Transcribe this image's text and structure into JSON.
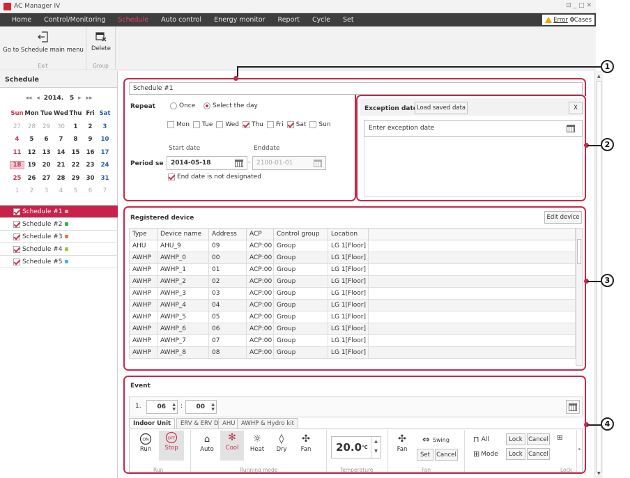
{
  "window": {
    "title": "AC Manager IV",
    "controls": "⊡ _ □ ✕"
  },
  "menu": {
    "items": [
      "Home",
      "Control/Monitoring",
      "Schedule",
      "Auto control",
      "Energy monitor",
      "Report",
      "Cycle",
      "Set"
    ],
    "active": "Schedule",
    "error_label": "Error",
    "error_count": "0",
    "error_suffix": "Cases"
  },
  "toolbar": {
    "go_main_label": "Go to Schedule main menu",
    "delete_label": "Delete",
    "group1": "Exit",
    "group2": "Group"
  },
  "left": {
    "title": "Schedule",
    "cal_nav": {
      "prev_year": "◂◂",
      "prev": "◂",
      "year": "2014.",
      "month": "5",
      "next": "▸",
      "next_year": "▸▸"
    },
    "weekdays": [
      "Sun",
      "Mon",
      "Tue",
      "Wed",
      "Thu",
      "Fri",
      "Sat"
    ],
    "weeks": [
      [
        "27",
        "28",
        "29",
        "30",
        "1",
        "2",
        "3"
      ],
      [
        "4",
        "5",
        "6",
        "7",
        "8",
        "9",
        "10"
      ],
      [
        "11",
        "12",
        "13",
        "14",
        "15",
        "16",
        "17"
      ],
      [
        "18",
        "19",
        "20",
        "21",
        "22",
        "23",
        "24"
      ],
      [
        "25",
        "26",
        "27",
        "28",
        "29",
        "30",
        "31"
      ],
      [
        "1",
        "2",
        "3",
        "4",
        "5",
        "6",
        "7"
      ]
    ],
    "schedules": [
      {
        "label": "Schedule #1",
        "color": "#f0a0b4"
      },
      {
        "label": "Schedule #2",
        "color": "#3cb04a"
      },
      {
        "label": "Schedule #3",
        "color": "#f07850"
      },
      {
        "label": "Schedule #4",
        "color": "#a0c83c"
      },
      {
        "label": "Schedule #5",
        "color": "#50b4e6"
      }
    ]
  },
  "schedule": {
    "name": "Schedule #1",
    "repeat_label": "Repeat",
    "once_label": "Once",
    "select_day_label": "Select the day",
    "days": [
      {
        "label": "Mon",
        "checked": false
      },
      {
        "label": "Tue",
        "checked": false
      },
      {
        "label": "Wed",
        "checked": false
      },
      {
        "label": "Thu",
        "checked": true
      },
      {
        "label": "Fri",
        "checked": false
      },
      {
        "label": "Sat",
        "checked": true
      },
      {
        "label": "Sun",
        "checked": false
      }
    ],
    "period_label": "Period se",
    "start_caption": "Start date",
    "end_caption": "Enddate",
    "start_date": "2014-05-18",
    "end_date": "2100-01-01",
    "dash": "-",
    "end_not_designated": "End date is not designated"
  },
  "exception": {
    "title": "Exception date",
    "load_button": "Load saved data",
    "close": "X",
    "placeholder": "Enter exception date"
  },
  "devices": {
    "title": "Registered device",
    "edit_button": "Edit device",
    "columns": [
      "Type",
      "Device name",
      "Address",
      "ACP",
      "Control group",
      "Location"
    ],
    "rows": [
      [
        "AHU",
        "AHU_9",
        "09",
        "ACP:00",
        "Group",
        "LG 1[Floor]"
      ],
      [
        "AWHP",
        "AWHP_0",
        "00",
        "ACP:00",
        "Group",
        "LG 1[Floor]"
      ],
      [
        "AWHP",
        "AWHP_1",
        "01",
        "ACP:00",
        "Group",
        "LG 1[Floor]"
      ],
      [
        "AWHP",
        "AWHP_2",
        "02",
        "ACP:00",
        "Group",
        "LG 1[Floor]"
      ],
      [
        "AWHP",
        "AWHP_3",
        "03",
        "ACP:00",
        "Group",
        "LG 1[Floor]"
      ],
      [
        "AWHP",
        "AWHP_4",
        "04",
        "ACP:00",
        "Group",
        "LG 1[Floor]"
      ],
      [
        "AWHP",
        "AWHP_5",
        "05",
        "ACP:00",
        "Group",
        "LG 1[Floor]"
      ],
      [
        "AWHP",
        "AWHP_6",
        "06",
        "ACP:00",
        "Group",
        "LG 1[Floor]"
      ],
      [
        "AWHP",
        "AWHP_7",
        "07",
        "ACP:00",
        "Group",
        "LG 1[Floor]"
      ],
      [
        "AWHP",
        "AWHP_8",
        "08",
        "ACP:00",
        "Group",
        "LG 1[Floor]"
      ]
    ]
  },
  "event": {
    "title": "Event",
    "index": "1.",
    "hour": "06",
    "minute": "00",
    "colon": ":",
    "tabs": [
      "Indoor Unit",
      "ERV & ERV DX",
      "AHU",
      "AWHP & Hydro kit"
    ],
    "run": "Run",
    "stop": "Stop",
    "auto": "Auto",
    "cool": "Cool",
    "heat": "Heat",
    "dry": "Dry",
    "fan": "Fan",
    "temperature": "20.0",
    "temp_unit": "°C",
    "fan_label": "Fan",
    "swing": "Swing",
    "set": "Set",
    "cancel": "Cancel",
    "lock_all": "All",
    "lock_mode": "Mode",
    "lock": "Lock",
    "group_run": "Run",
    "group_mode": "Running mode",
    "group_temp": "Temperature",
    "group_fan": "Fan",
    "group_lock": "Lock"
  },
  "callouts": [
    "1",
    "2",
    "3",
    "4"
  ],
  "colors": {
    "accent": "#c6294a",
    "menubar": "#3e3e3e"
  }
}
